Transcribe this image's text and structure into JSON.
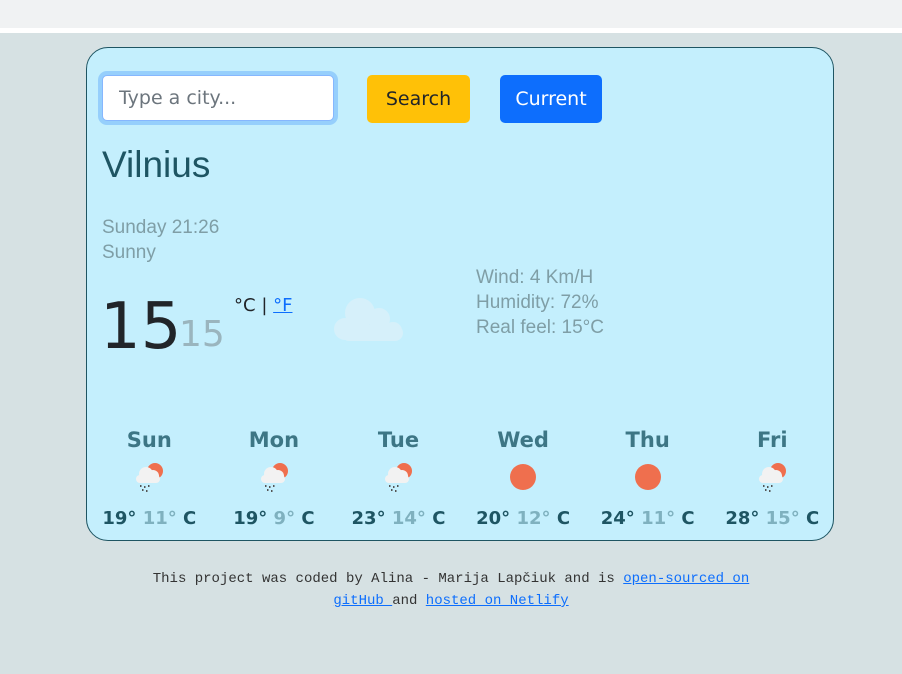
{
  "search": {
    "placeholder": "Type a city...",
    "value": "",
    "search_label": "Search",
    "current_label": "Current"
  },
  "weather": {
    "city": "Vilnius",
    "datetime": "Sunday 21:26",
    "description": "Sunny",
    "temperature": "15",
    "feels_like_temp": "15",
    "unit_celsius": "°C",
    "unit_separator": "|",
    "unit_fahrenheit": "°F",
    "main_icon": "cloud-icon",
    "wind": "Wind: 4 Km/H",
    "humidity": "Humidity: 72%",
    "real_feel": "Real feel: 15°C"
  },
  "forecast": [
    {
      "day": "Sun",
      "icon": "rain-cloud-sun-icon",
      "max": "19°",
      "min": "11°",
      "unit": "C"
    },
    {
      "day": "Mon",
      "icon": "rain-cloud-sun-icon",
      "max": "19°",
      "min": "9°",
      "unit": "C"
    },
    {
      "day": "Tue",
      "icon": "rain-cloud-sun-icon",
      "max": "23°",
      "min": "14°",
      "unit": "C"
    },
    {
      "day": "Wed",
      "icon": "sun-icon",
      "max": "20°",
      "min": "12°",
      "unit": "C"
    },
    {
      "day": "Thu",
      "icon": "sun-icon",
      "max": "24°",
      "min": "11°",
      "unit": "C"
    },
    {
      "day": "Fri",
      "icon": "rain-cloud-sun-icon",
      "max": "28°",
      "min": "15°",
      "unit": "C"
    }
  ],
  "footer": {
    "text_1": "This project was coded by Alina - Marija Lapčiuk and is ",
    "link_github": "open-sourced on gitHub ",
    "text_2": "and ",
    "link_netlify": "hosted on Netlify"
  },
  "colors": {
    "card_bg": "#c4effd",
    "accent_dark": "#1e5563",
    "search_btn": "#ffc107",
    "current_btn": "#0d6efd",
    "sun": "#ef6f4e"
  }
}
